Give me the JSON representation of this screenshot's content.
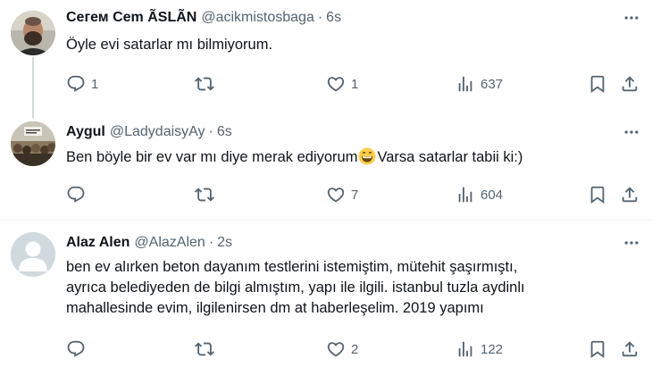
{
  "tweets": [
    {
      "name": "Ceгем Cem ÃSLÃN",
      "handle": "@acikmistosbaga",
      "separator": "·",
      "time": "6s",
      "text": "Öyle evi satarlar mı bilmiyorum.",
      "replies": "1",
      "retweets": "",
      "likes": "1",
      "views": "637"
    },
    {
      "name": "Aygul",
      "handle": "@LadydaisyAy",
      "separator": "·",
      "time": "6s",
      "text_before_emoji": "Ben böyle bir ev var mı diye merak ediyorum",
      "text_after_emoji": "Varsa satarlar tabii ki:)",
      "replies": "",
      "retweets": "",
      "likes": "7",
      "views": "604"
    },
    {
      "name": "Alaz Alen",
      "handle": "@AlazAlen",
      "separator": "·",
      "time": "2s",
      "text_line1": "ben ev alırken beton dayanım testlerini istemiştim, mütehit şaşırmıştı,",
      "text_line2": "ayrıca belediyeden de bilgi almıştım, yapı ile ilgili. istanbul tuzla aydinlı",
      "text_line3": "mahallesinde evim, ilgilenirsen dm at haberleşelim. 2019 yapımı",
      "replies": "",
      "retweets": "",
      "likes": "2",
      "views": "122"
    }
  ],
  "icons": [
    "reply-icon",
    "retweet-icon",
    "like-icon",
    "views-icon",
    "bookmark-icon",
    "share-icon",
    "more-icon",
    "grinning-emoji"
  ],
  "colors": {
    "text": "#0f1419",
    "secondary": "#536471",
    "divider": "#eff3f4",
    "thread_line": "#cfd9de"
  }
}
